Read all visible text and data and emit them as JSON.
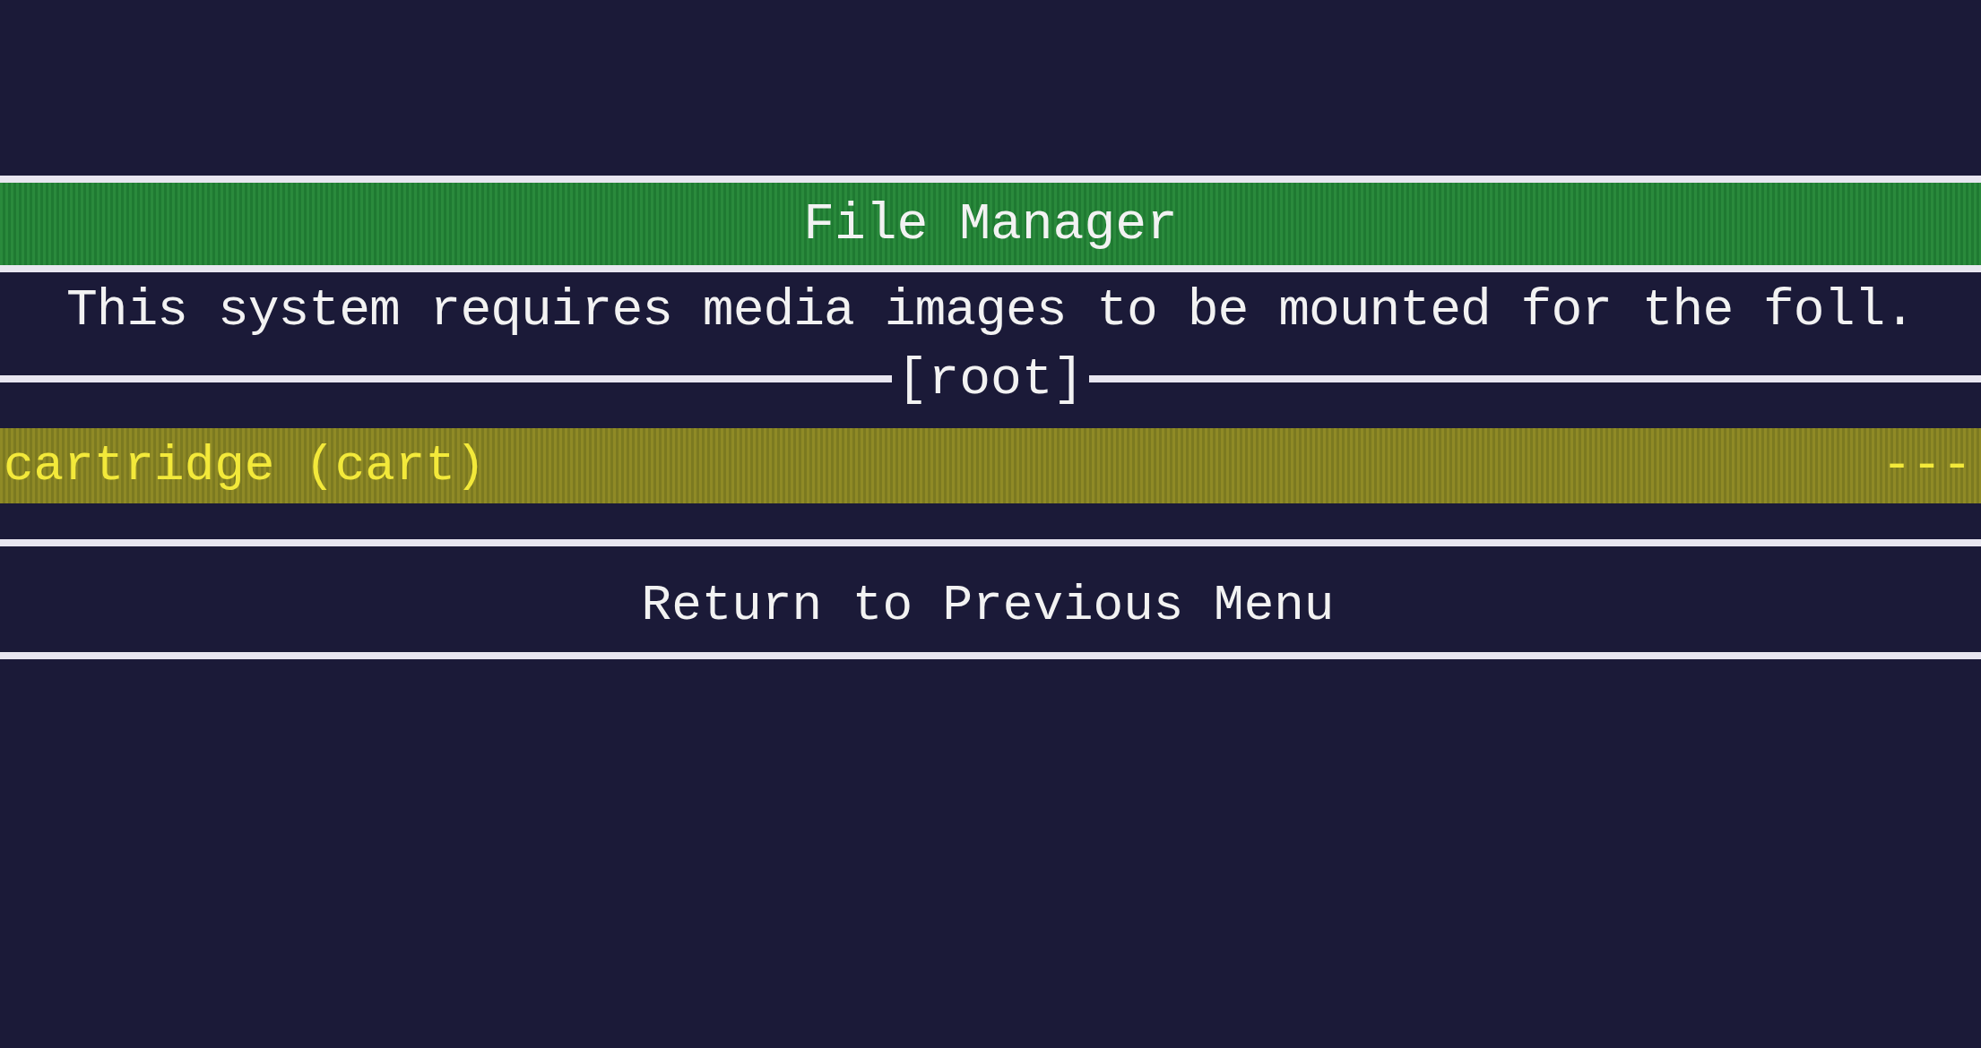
{
  "title": "File Manager",
  "message": "This system requires media images to be mounted for the foll.",
  "section": "[root]",
  "items": [
    {
      "label": "cartridge (cart)",
      "value": "---",
      "selected": true
    }
  ],
  "footer_items": [
    {
      "label": "Return to Previous Menu",
      "selected": false
    }
  ]
}
